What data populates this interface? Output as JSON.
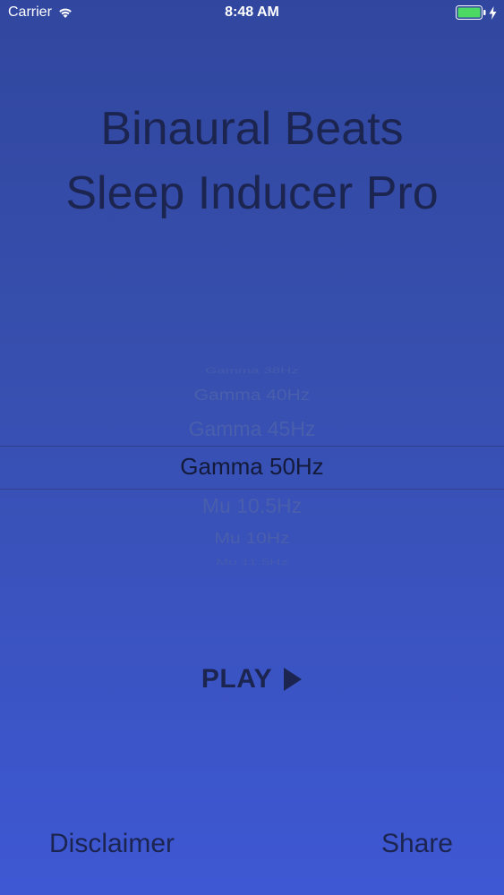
{
  "status_bar": {
    "carrier": "Carrier",
    "time": "8:48 AM",
    "battery_color": "#4cd964"
  },
  "title": {
    "line1": "Binaural Beats",
    "line2": "Sleep Inducer Pro"
  },
  "picker": {
    "items": [
      "Gamma 38Hz",
      "Gamma 40Hz",
      "Gamma 45Hz",
      "Gamma 50Hz",
      "Mu 10.5Hz",
      "Mu 10Hz",
      "Mu 11.5Hz"
    ],
    "selected": "Gamma 50Hz"
  },
  "play": {
    "label": "PLAY",
    "icon": "play-triangle-icon"
  },
  "footer": {
    "disclaimer": "Disclaimer",
    "share": "Share"
  },
  "colors": {
    "background_top": "#31479f",
    "background_bottom": "#3e58d4",
    "text": "#1c2450"
  }
}
